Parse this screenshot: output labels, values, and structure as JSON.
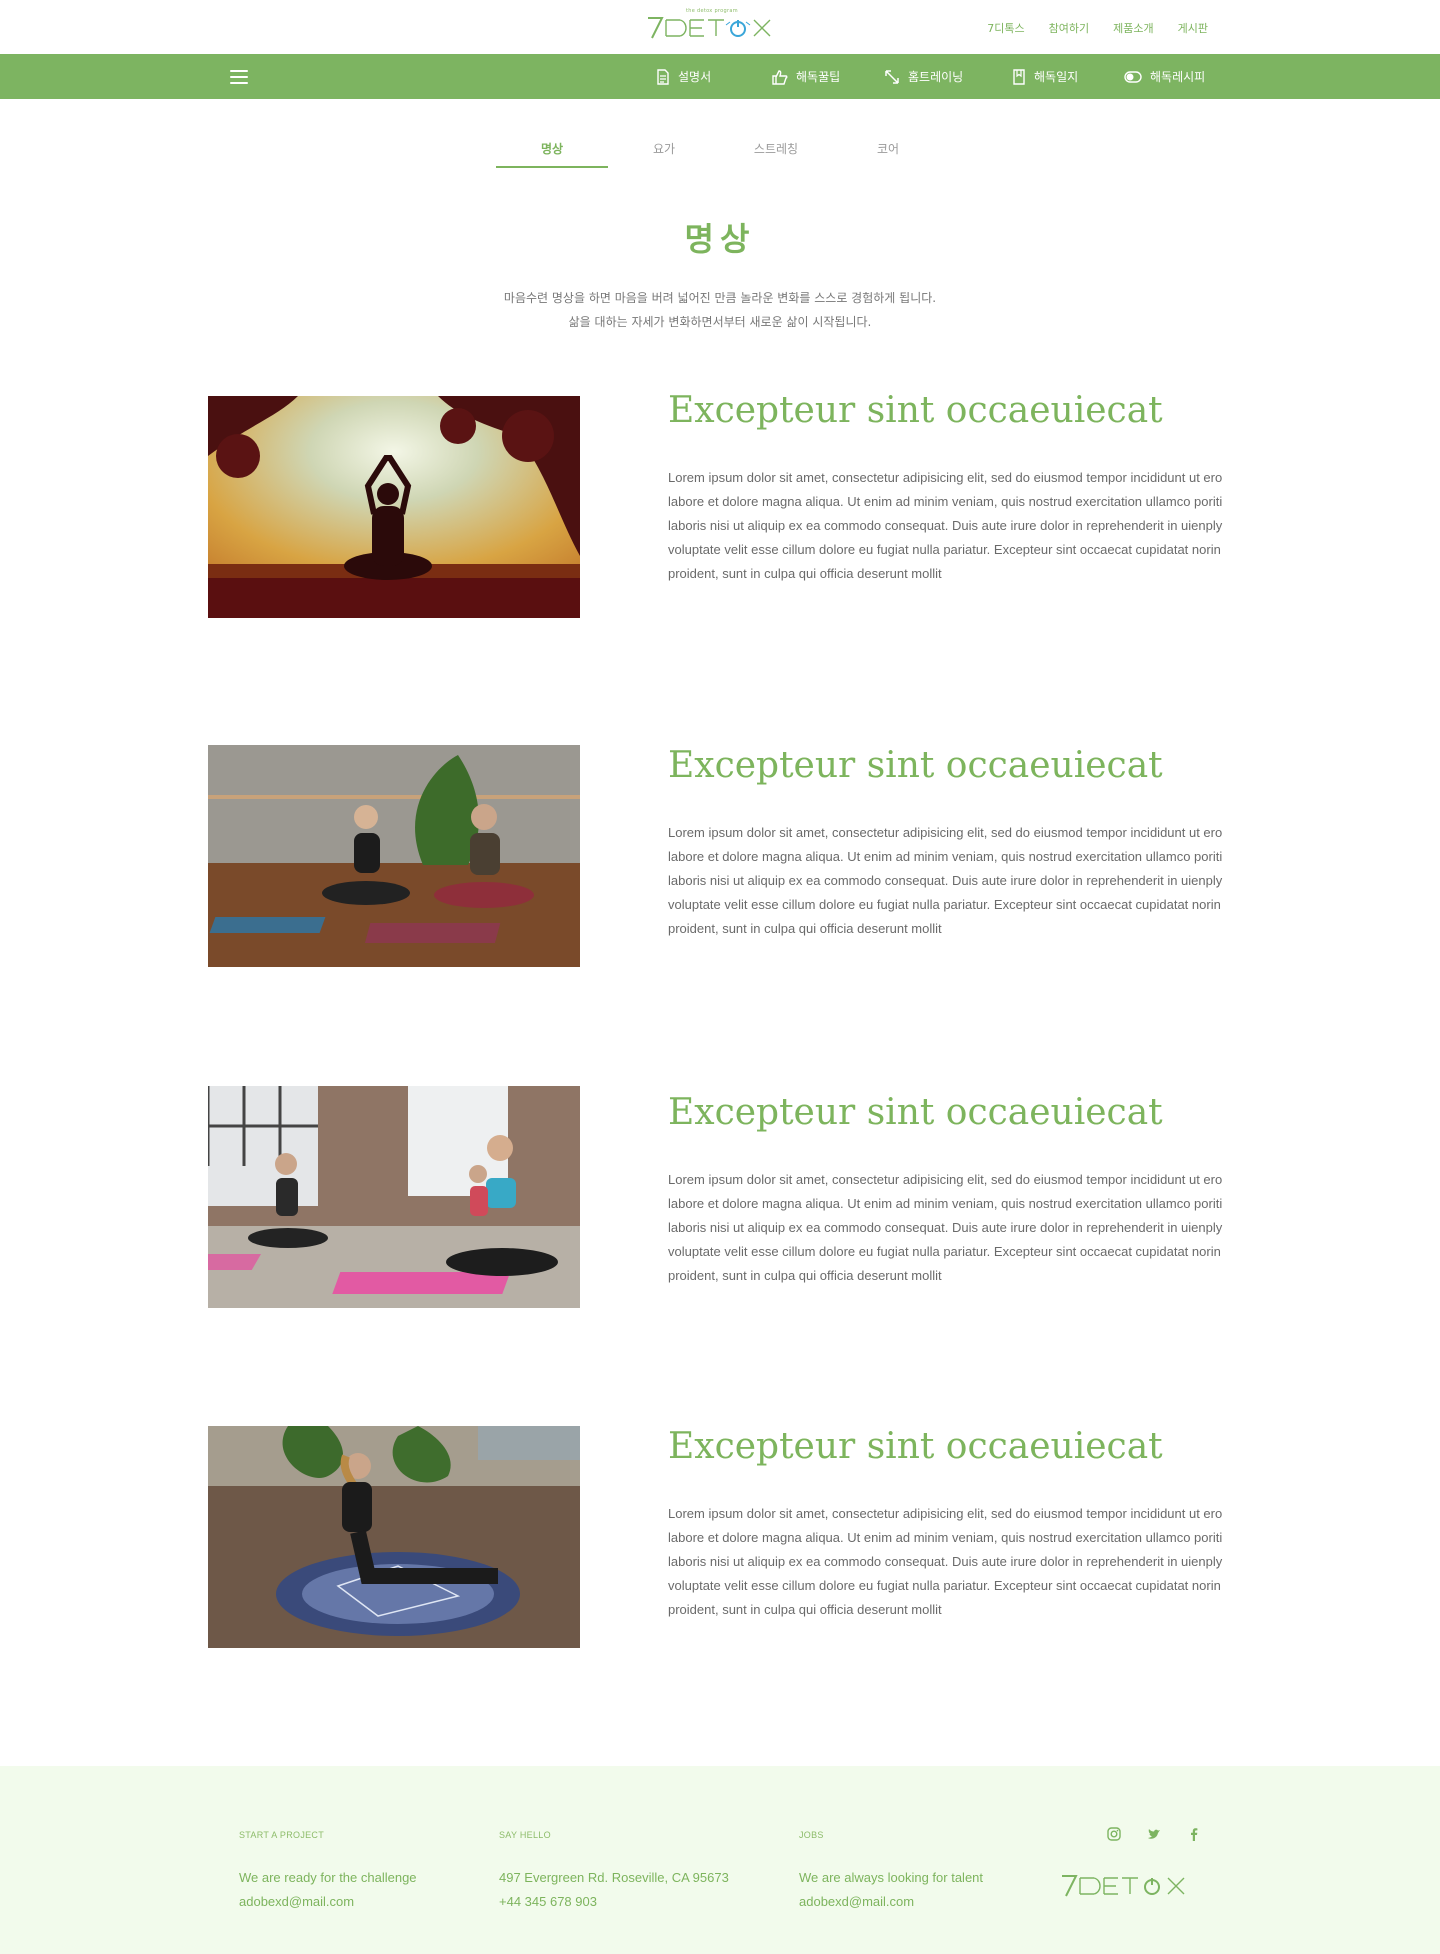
{
  "header": {
    "logo_text": "7DETOX",
    "logo_tagline": "the detox program",
    "top_links": [
      "7디톡스",
      "참여하기",
      "제품소개",
      "게시판"
    ]
  },
  "nav": {
    "items": [
      {
        "label": "설명서",
        "icon": "document-icon"
      },
      {
        "label": "해독꿀팁",
        "icon": "thumbs-up-icon"
      },
      {
        "label": "홈트레이닝",
        "icon": "expand-arrows-icon"
      },
      {
        "label": "해독일지",
        "icon": "journal-icon"
      },
      {
        "label": "해독레시피",
        "icon": "toggle-icon"
      }
    ]
  },
  "tabs": [
    {
      "label": "명상",
      "active": true
    },
    {
      "label": "요가",
      "active": false
    },
    {
      "label": "스트레칭",
      "active": false
    },
    {
      "label": "코어",
      "active": false
    }
  ],
  "section": {
    "title": "명상",
    "intro_line1": "마음수련 명상을 하면 마음을 버려 넓어진 만큼 놀라운 변화를 스스로 경험하게 됩니다.",
    "intro_line2": "삶을 대하는 자세가 변화하면서부터 새로운 삶이 시작됩니다."
  },
  "articles": [
    {
      "title": "Excepteur sint occaeuiecat",
      "body": "Lorem ipsum dolor sit amet, consectetur adipisicing elit, sed do eiusmod tempor incididunt ut ero labore et dolore magna aliqua. Ut enim ad minim veniam, quis nostrud exercitation ullamco poriti laboris nisi ut aliquip ex ea commodo consequat. Duis aute irure dolor in reprehenderit in uienply voluptate velit esse cillum dolore eu fugiat nulla pariatur. Excepteur sint occaecat cupidatat norin proident, sunt in culpa qui officia deserunt mollit"
    },
    {
      "title": "Excepteur sint occaeuiecat",
      "body": "Lorem ipsum dolor sit amet, consectetur adipisicing elit, sed do eiusmod tempor incididunt ut ero labore et dolore magna aliqua. Ut enim ad minim veniam, quis nostrud exercitation ullamco poriti laboris nisi ut aliquip ex ea commodo consequat. Duis aute irure dolor in reprehenderit in uienply voluptate velit esse cillum dolore eu fugiat nulla pariatur. Excepteur sint occaecat cupidatat norin proident, sunt in culpa qui officia deserunt mollit"
    },
    {
      "title": "Excepteur sint occaeuiecat",
      "body": "Lorem ipsum dolor sit amet, consectetur adipisicing elit, sed do eiusmod tempor incididunt ut ero labore et dolore magna aliqua. Ut enim ad minim veniam, quis nostrud exercitation ullamco poriti laboris nisi ut aliquip ex ea commodo consequat. Duis aute irure dolor in reprehenderit in uienply voluptate velit esse cillum dolore eu fugiat nulla pariatur. Excepteur sint occaecat cupidatat norin proident, sunt in culpa qui officia deserunt mollit"
    },
    {
      "title": "Excepteur sint occaeuiecat",
      "body": "Lorem ipsum dolor sit amet, consectetur adipisicing elit, sed do eiusmod tempor incididunt ut ero labore et dolore magna aliqua. Ut enim ad minim veniam, quis nostrud exercitation ullamco poriti laboris nisi ut aliquip ex ea commodo consequat. Duis aute irure dolor in reprehenderit in uienply voluptate velit esse cillum dolore eu fugiat nulla pariatur. Excepteur sint occaecat cupidatat norin proident, sunt in culpa qui officia deserunt mollit"
    }
  ],
  "footer": {
    "columns": [
      {
        "heading": "START A PROJECT",
        "line1": "We are ready for the challenge",
        "line2": "adobexd@mail.com"
      },
      {
        "heading": "SAY HELLO",
        "line1": "497 Evergreen Rd. Roseville, CA 95673",
        "line2": "+44 345 678 903"
      },
      {
        "heading": "JOBS",
        "line1": "We are always looking for talent",
        "line2": "adobexd@mail.com"
      }
    ],
    "social": [
      "instagram-icon",
      "twitter-icon",
      "facebook-icon"
    ]
  },
  "colors": {
    "brand_green": "#7db461",
    "footer_bg": "#f2fbec",
    "logo_blue": "#3aa6d9"
  }
}
